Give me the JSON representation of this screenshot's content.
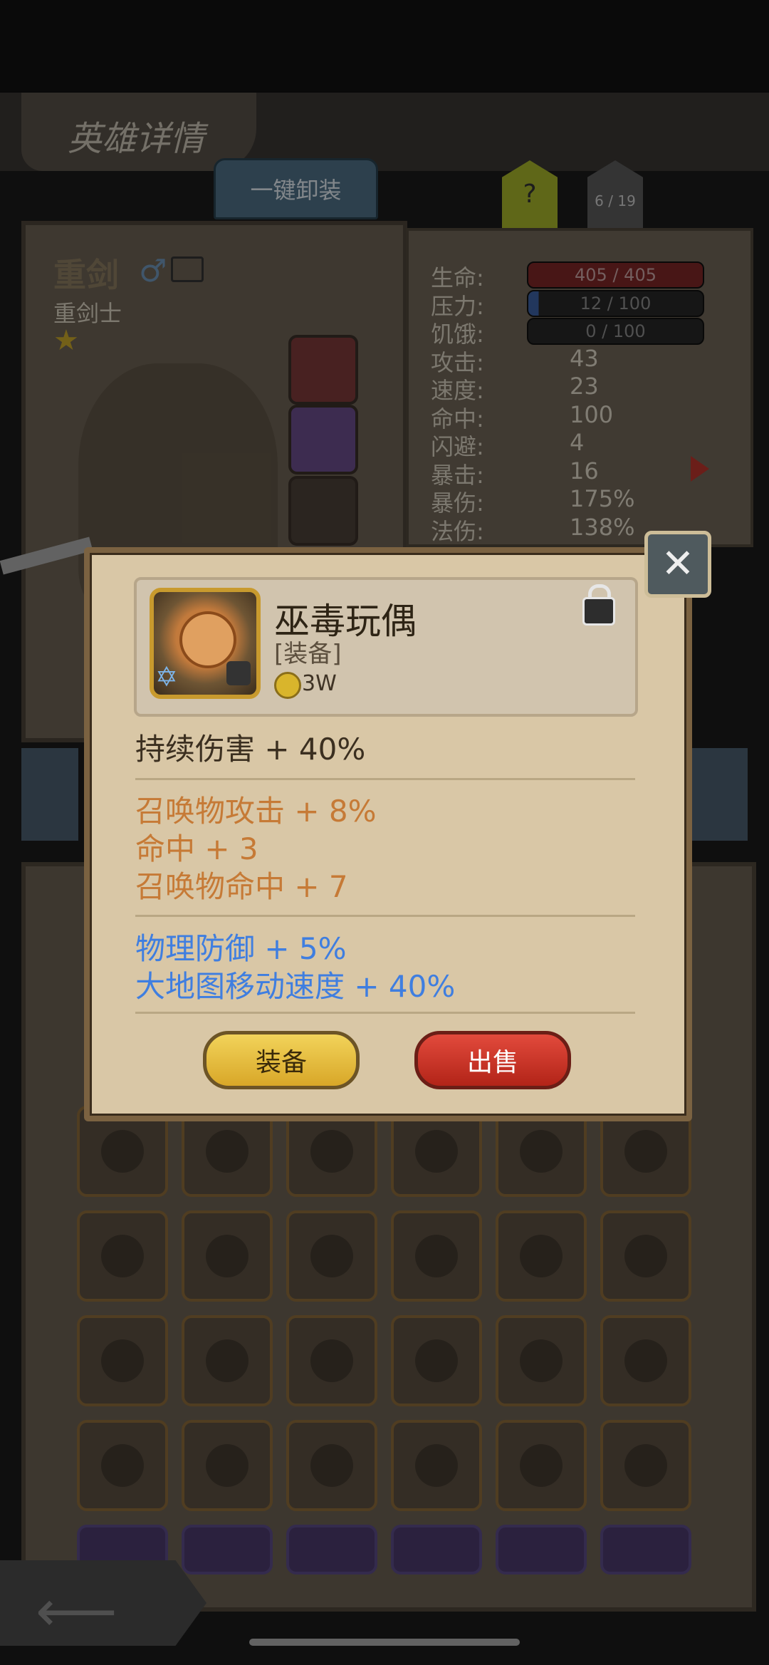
{
  "header": {
    "title": "英雄详情",
    "unequip_all": "一键卸装",
    "help": "?",
    "page_count": "6 / 19"
  },
  "hero": {
    "name": "重剑",
    "gender_icon": "male-icon",
    "class": "重剑士"
  },
  "stats": [
    {
      "label": "生命:",
      "value": "405 / 405",
      "kind": "hp-bar"
    },
    {
      "label": "压力:",
      "value": "12 / 100",
      "kind": "pressure-bar"
    },
    {
      "label": "饥饿:",
      "value": "0 / 100",
      "kind": "hunger-bar"
    },
    {
      "label": "攻击:",
      "value": "43"
    },
    {
      "label": "速度:",
      "value": "23"
    },
    {
      "label": "命中:",
      "value": "100"
    },
    {
      "label": "闪避:",
      "value": "4"
    },
    {
      "label": "暴击:",
      "value": "16"
    },
    {
      "label": "暴伤:",
      "value": "175%"
    },
    {
      "label": "法伤:",
      "value": "138%"
    }
  ],
  "popup": {
    "item_name": "巫毒玩偶",
    "item_type": "[装备]",
    "price": "3W",
    "main_attr": "持续伤害 + 40%",
    "orange_attrs": [
      "召唤物攻击 + 8%",
      "命中 + 3",
      "召唤物命中 + 7"
    ],
    "blue_attrs": [
      "物理防御 + 5%",
      "大地图移动速度 + 40%"
    ],
    "equip_label": "装备",
    "sell_label": "出售",
    "colors": {
      "orange": "#c67a36",
      "blue": "#3f7ee0",
      "equip": "#e8c246",
      "sell": "#c8362a"
    }
  },
  "inventory_rows": [
    [
      "sword-icon",
      "book-icon",
      "staff-icon",
      "scepter-icon",
      "purple-blade-icon",
      "purple-blade-icon"
    ],
    [
      "eye-staff-icon",
      "ring-icon",
      "axe-icon",
      "voodoo-doll-icon",
      "armor-icon",
      "armor-icon"
    ],
    [
      "charm-icon",
      "amulet-icon",
      "shield-icon",
      "helmet-icon",
      "voodoo-doll-icon",
      "hat-icon"
    ],
    [
      "horn-icon",
      "gauntlet-icon",
      "claw-icon",
      "claw-icon",
      "red-sword-icon",
      "charm-icon"
    ]
  ]
}
